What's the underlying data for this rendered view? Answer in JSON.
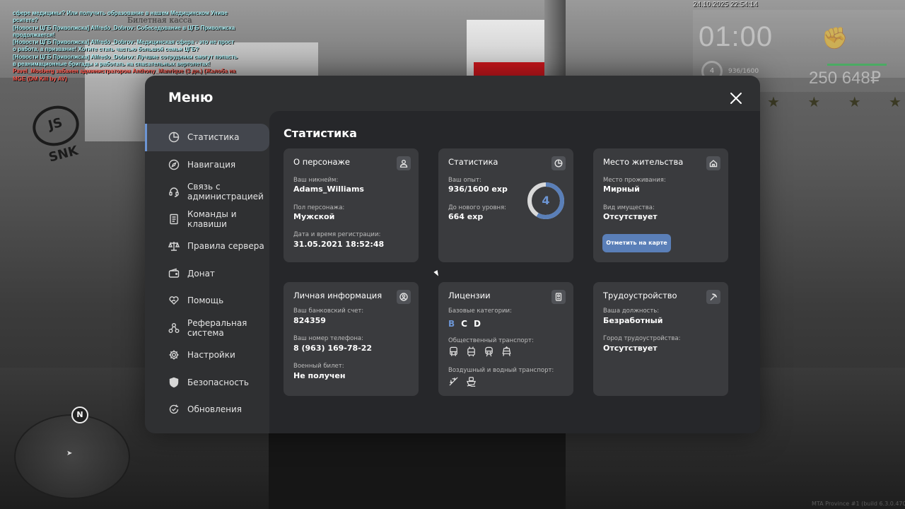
{
  "chat": [
    {
      "text": " сфере медицины? Или получить образование в нашем Медицинском Униве",
      "red": false
    },
    {
      "text": "рситете?",
      "red": false
    },
    {
      "text": "[Новости ЦГБ Приволжска] Alfredo_Dobrov: Собеседование в ЦГБ Приволжска",
      "red": false
    },
    {
      "text": "продолжается!",
      "red": false
    },
    {
      "text": "[Новости ЦГБ Приволжска] Alfredo_Dobrov: Медицинская сфера - это не прост",
      "red": false
    },
    {
      "text": "о работа, а призвание! Хотите стать частью большой семьи ЦГБ?",
      "red": false
    },
    {
      "text": "[Новости ЦГБ Приволжска] Alfredo_Dobrov: Лучшие сотрудники смогут попасть",
      "red": false
    },
    {
      "text": " в реанимационные бригады и работать на спасательных вертолетах!",
      "red": false
    },
    {
      "text": "Pavel_Mosberg забанен администратором Anthony_Manrique (3 дн.) (Жалоба на",
      "red": true
    },
    {
      "text": "MGE (DM Kill by AV)",
      "red": true
    }
  ],
  "hud": {
    "datetime": "24.10.2025 22:54:14",
    "time": "01:00",
    "level": "4",
    "exp": "936/1600",
    "money": "250 648₽",
    "stars": [
      "★",
      "★",
      "★",
      "★"
    ]
  },
  "world": {
    "sign": "Билетная касса",
    "logo": "JS SNK"
  },
  "minimap": {
    "north": "N"
  },
  "watermark": "MTA Province #1 (build 6.3.0.4700)",
  "menu": {
    "title": "Меню",
    "sidebar": [
      {
        "label": "Статистика",
        "icon": "pie-chart-icon",
        "active": true
      },
      {
        "label": "Навигация",
        "icon": "compass-icon",
        "active": false
      },
      {
        "label": "Связь с\nадминистрацией",
        "icon": "headset-icon",
        "active": false
      },
      {
        "label": "Команды и\nклавиши",
        "icon": "document-icon",
        "active": false
      },
      {
        "label": "Правила сервера",
        "icon": "scales-icon",
        "active": false
      },
      {
        "label": "Донат",
        "icon": "wallet-icon",
        "active": false
      },
      {
        "label": "Помощь",
        "icon": "heart-hand-icon",
        "active": false
      },
      {
        "label": "Реферальная\nсистема",
        "icon": "referral-icon",
        "active": false
      },
      {
        "label": "Настройки",
        "icon": "gear-icon",
        "active": false
      },
      {
        "label": "Безопасность",
        "icon": "shield-icon",
        "active": false
      },
      {
        "label": "Обновления",
        "icon": "refresh-check-icon",
        "active": false
      }
    ],
    "content_title": "Статистика",
    "cards": {
      "character": {
        "title": "О персонаже",
        "nickname_label": "Ваш никнейм:",
        "nickname": "Adams_Williams",
        "gender_label": "Пол персонажа:",
        "gender": "Мужской",
        "reg_label": "Дата и время регистрации:",
        "reg": "31.05.2021 18:52:48"
      },
      "stats": {
        "title": "Статистика",
        "exp_label": "Ваш опыт:",
        "exp": "936/1600 exp",
        "next_label": "До нового уровня:",
        "next": "664 exp",
        "level": "4",
        "progress": 0.585
      },
      "residence": {
        "title": "Место жительства",
        "place_label": "Место проживания:",
        "place": "Мирный",
        "property_label": "Вид имущества:",
        "property": "Отсутствует",
        "button": "Отметить на карте"
      },
      "personal": {
        "title": "Личная информация",
        "bank_label": "Ваш банковский счет:",
        "bank": "824359",
        "phone_label": "Ваш номер телефона:",
        "phone": "8 (963) 169-78-22",
        "military_label": "Военный билет:",
        "military": "Не получен"
      },
      "licenses": {
        "title": "Лицензии",
        "base_label": "Базовые категории:",
        "categories": [
          {
            "name": "B",
            "owned": true
          },
          {
            "name": "C",
            "owned": false
          },
          {
            "name": "D",
            "owned": false
          }
        ],
        "public_label": "Общественный транспорт:",
        "public_icons": [
          "bus-icon",
          "trolleybus-icon",
          "train-icon",
          "tram-icon"
        ],
        "air_water_label": "Воздушный и водный транспорт:",
        "air_water_icons": [
          "plane-icon",
          "boat-icon"
        ]
      },
      "employment": {
        "title": "Трудоустройство",
        "position_label": "Ваша должность:",
        "position": "Безработный",
        "city_label": "Город трудоустройства:",
        "city": "Отсутствует"
      }
    }
  },
  "colors": {
    "accent": "#6c95d4",
    "button": "#5a7fb8",
    "panel": "#2f3032",
    "content": "#26272a",
    "card": "#3a3b3e"
  }
}
